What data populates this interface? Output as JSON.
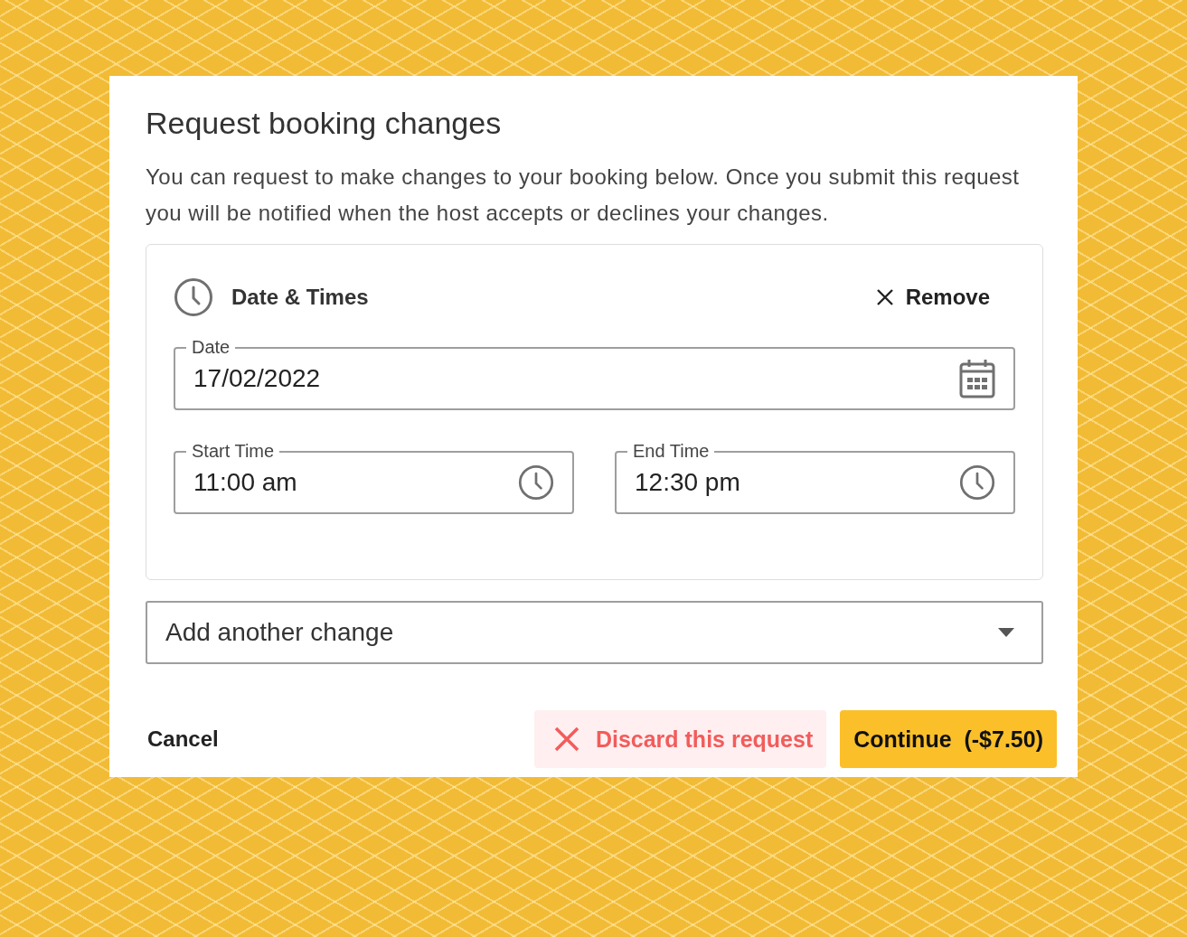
{
  "dialog": {
    "title": "Request booking changes",
    "description": "You can request to make changes to your booking below. Once you submit this request you will be notified when the host accepts or declines your changes."
  },
  "section": {
    "title": "Date & Times",
    "remove": "Remove",
    "fields": [
      {
        "kind": "date",
        "label": "Date",
        "value": "17/02/2022"
      },
      {
        "kind": "time",
        "label": "Start Time",
        "value": "11:00 am"
      },
      {
        "kind": "time",
        "label": "End Time",
        "value": "12:30 pm"
      }
    ]
  },
  "add_change": {
    "value": "Add another change"
  },
  "footer": {
    "cancel": "Cancel",
    "discard": "Discard this request",
    "continue": "Continue  (-$7.50)"
  }
}
